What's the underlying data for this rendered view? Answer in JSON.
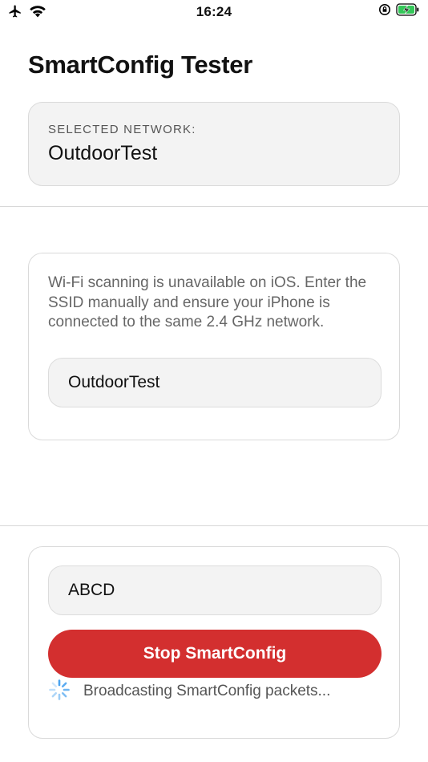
{
  "status_bar": {
    "time": "16:24",
    "icons": [
      "airplane-icon",
      "wifi-icon",
      "orientation-lock-icon",
      "battery-charging-icon"
    ],
    "battery_color": "#34c759"
  },
  "app": {
    "title": "SmartConfig Tester"
  },
  "selected_network": {
    "label": "SELECTED NETWORK:",
    "value": "OutdoorTest"
  },
  "ssid_section": {
    "info": "Wi-Fi scanning is unavailable on iOS. Enter the SSID manually and ensure your iPhone is connected to the same 2.4 GHz network.",
    "ssid_value": "OutdoorTest"
  },
  "password_section": {
    "password_value": "ABCD",
    "stop_button_label": "Stop SmartConfig",
    "stop_button_color": "#d32f2f",
    "status_text": "Broadcasting SmartConfig packets...",
    "spinner_color": "#4aa3f0"
  }
}
